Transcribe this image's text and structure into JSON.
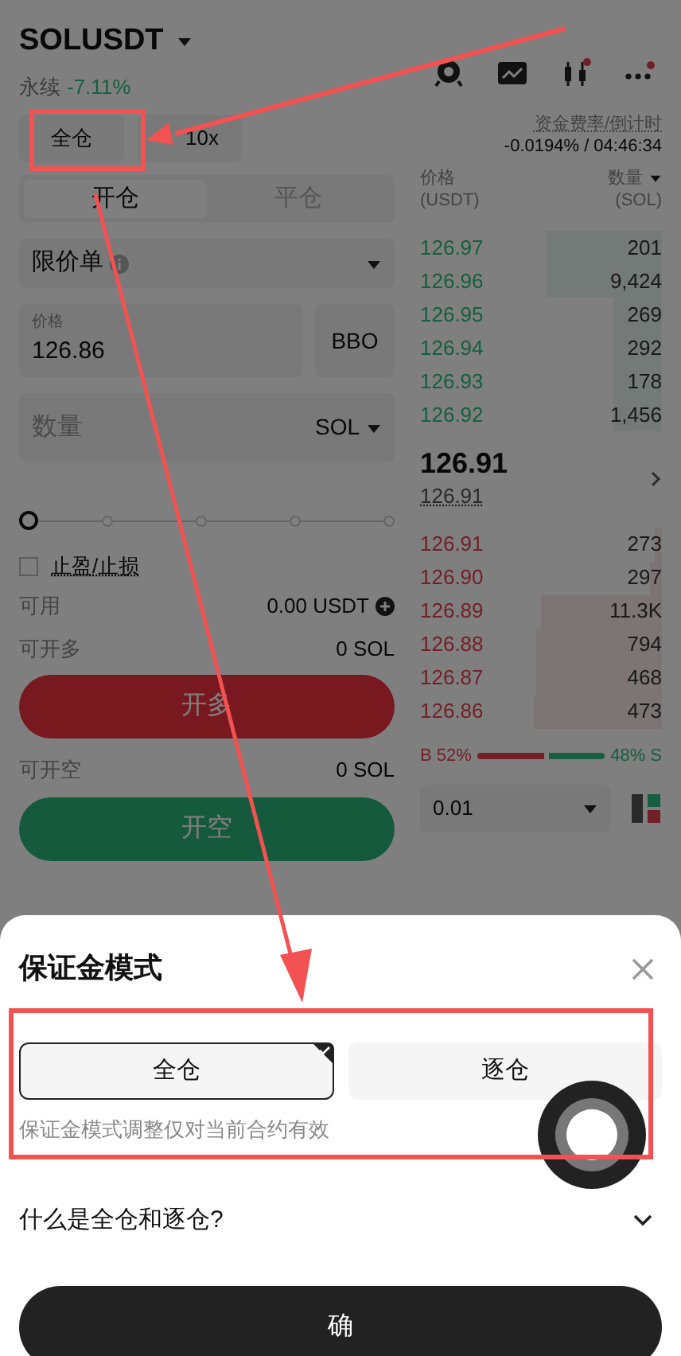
{
  "header": {
    "symbol": "SOLUSDT",
    "subtitle": "永续",
    "change": "-7.11%"
  },
  "margin_mode_button": "全仓",
  "leverage_button": "10x",
  "funding": {
    "label": "资金费率/倒计时",
    "value": "-0.0194% / 04:46:34"
  },
  "tabs": [
    {
      "label": "开仓",
      "selected": true
    },
    {
      "label": "平仓",
      "selected": false
    }
  ],
  "order_type": "限价单",
  "price_field": {
    "label": "价格",
    "value": "126.86"
  },
  "bbo_button": "BBO",
  "quantity_field": {
    "placeholder": "数量",
    "unit": "SOL"
  },
  "slider": {
    "level": 0
  },
  "tp_sl": {
    "label": "止盈/止损",
    "checked": false
  },
  "available": {
    "label": "可用",
    "value": "0.00 USDT"
  },
  "can_long": {
    "label": "可开多",
    "value": "0 SOL"
  },
  "long_button": "开多",
  "can_short": {
    "label": "可开空",
    "value": "0 SOL"
  },
  "short_button": "开空",
  "orderbook": {
    "price_header": "价格",
    "price_unit": "(USDT)",
    "qty_header": "数量",
    "qty_unit": "(SOL)",
    "asks": [
      {
        "price": "126.97",
        "qty": "201"
      },
      {
        "price": "126.96",
        "qty": "9,424"
      },
      {
        "price": "126.95",
        "qty": "269"
      },
      {
        "price": "126.94",
        "qty": "292"
      },
      {
        "price": "126.93",
        "qty": "178"
      },
      {
        "price": "126.92",
        "qty": "1,456"
      }
    ],
    "last_price": "126.91",
    "mark_price": "126.91",
    "bids": [
      {
        "price": "126.91",
        "qty": "273"
      },
      {
        "price": "126.90",
        "qty": "297"
      },
      {
        "price": "126.89",
        "qty": "11.3K"
      },
      {
        "price": "126.88",
        "qty": "794"
      },
      {
        "price": "126.87",
        "qty": "468"
      },
      {
        "price": "126.86",
        "qty": "473"
      }
    ],
    "buy_label": "B 52%",
    "buy_ratio": {
      "level": 0.52
    },
    "sell_label": "48% S",
    "precision": "0.01"
  },
  "sheet": {
    "title": "保证金模式",
    "options": [
      {
        "label": "全仓",
        "selected": true
      },
      {
        "label": "逐仓",
        "selected": false
      }
    ],
    "note": "保证金模式调整仅对当前合约有效",
    "faq": {
      "label": "什么是全仓和逐仓?",
      "expanded": false
    },
    "confirm": "确"
  }
}
